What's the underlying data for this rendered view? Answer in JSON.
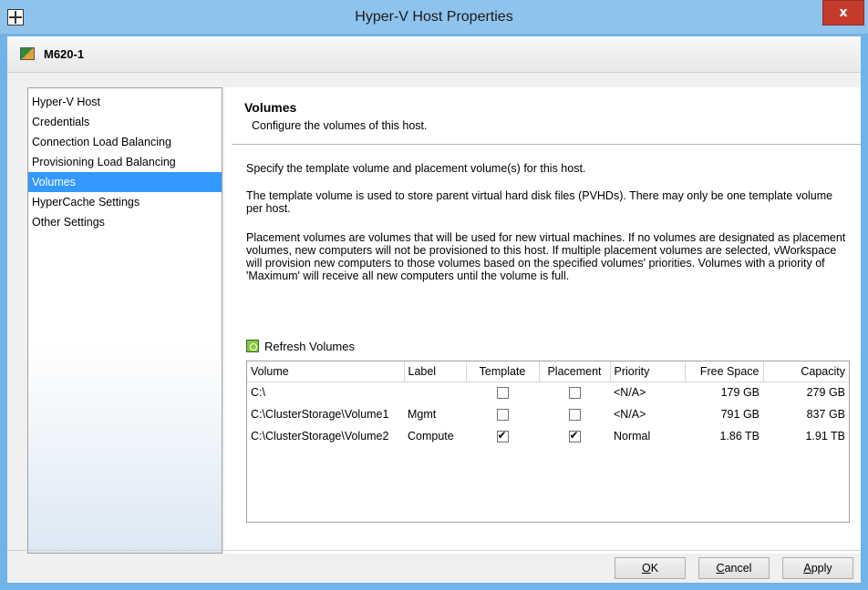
{
  "window": {
    "title": "Hyper-V Host Properties",
    "close_label": "x"
  },
  "host": {
    "name": "M620-1"
  },
  "nav": {
    "items": [
      {
        "label": "Hyper-V Host"
      },
      {
        "label": "Credentials"
      },
      {
        "label": "Connection Load Balancing"
      },
      {
        "label": "Provisioning Load Balancing"
      },
      {
        "label": "Volumes",
        "selected": true
      },
      {
        "label": "HyperCache Settings"
      },
      {
        "label": "Other Settings"
      }
    ]
  },
  "content": {
    "title": "Volumes",
    "subtitle": "Configure the volumes of this host.",
    "para1": "Specify the template volume and placement volume(s) for this host.",
    "para2": "The template volume is used to store parent virtual hard disk files (PVHDs).  There may only be one template volume per host.",
    "para3": "Placement volumes are volumes that will be used for new virtual machines.  If no volumes are designated as placement volumes, new computers will not be provisioned to this host.  If multiple placement volumes are selected, vWorkspace will provision new computers to those volumes based on the specified volumes' priorities.  Volumes with a priority of 'Maximum' will receive all new computers until the volume is full.",
    "refresh_label": "Refresh Volumes"
  },
  "table": {
    "headers": [
      "Volume",
      "Label",
      "Template",
      "Placement",
      "Priority",
      "Free Space",
      "Capacity"
    ],
    "rows": [
      {
        "volume": "C:\\",
        "label": "",
        "template": false,
        "placement": false,
        "priority": "<N/A>",
        "free": "179 GB",
        "capacity": "279 GB"
      },
      {
        "volume": "C:\\ClusterStorage\\Volume1",
        "label": "Mgmt",
        "template": false,
        "placement": false,
        "priority": "<N/A>",
        "free": "791 GB",
        "capacity": "837 GB"
      },
      {
        "volume": "C:\\ClusterStorage\\Volume2",
        "label": "Compute",
        "template": true,
        "placement": true,
        "priority": "Normal",
        "free": "1.86 TB",
        "capacity": "1.91 TB"
      }
    ]
  },
  "buttons": {
    "ok": {
      "pre": "",
      "ul": "O",
      "post": "K"
    },
    "cancel": {
      "pre": "",
      "ul": "C",
      "post": "ancel"
    },
    "apply": {
      "pre": "",
      "ul": "A",
      "post": "pply"
    }
  },
  "colors": {
    "selection": "#3399ff",
    "titlebar": "#8fc3ec",
    "close": "#c43b2c"
  }
}
